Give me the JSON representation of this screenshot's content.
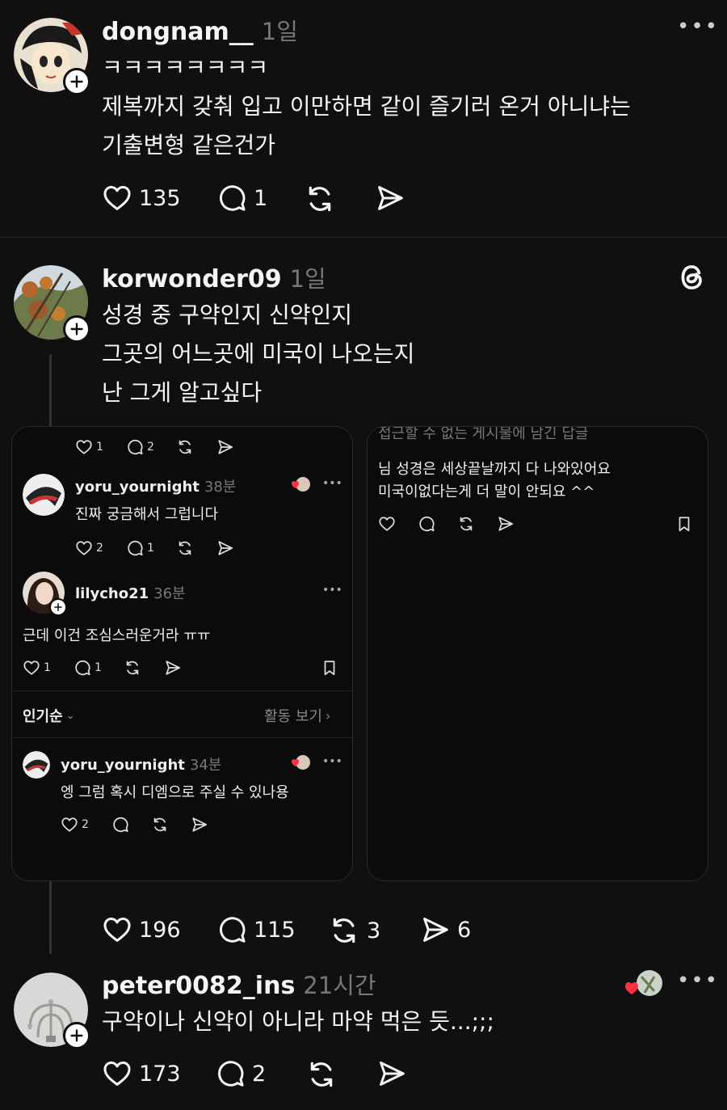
{
  "posts": [
    {
      "username": "dongnam__",
      "time": "1일",
      "lines": [
        "ㅋㅋㅋㅋㅋㅋㅋㅋ",
        "제복까지 갖춰 입고 이만하면 같이 즐기러 온거 아니냐는",
        "기출변형 같은건가"
      ],
      "likes": "135",
      "replies": "1"
    },
    {
      "username": "korwonder09",
      "time": "1일",
      "lines": [
        "성경 중 구약인지 신약인지",
        "그곳의 어느곳에 미국이 나오는지",
        "난 그게 알고싶다"
      ],
      "likes": "196",
      "replies": "115",
      "reposts": "3",
      "shares": "6"
    },
    {
      "username": "peter0082_ins",
      "time": "21시간",
      "lines": [
        "구약이나 신약이 아니라 마약 먹은 듯...;;;"
      ],
      "likes": "173",
      "replies": "2"
    }
  ],
  "left_card": {
    "top_likes": "1",
    "top_replies": "2",
    "reply1": {
      "username": "yoru_yournight",
      "time": "38분",
      "text": "진짜 궁금해서 그럽니다",
      "likes": "2",
      "replies": "1"
    },
    "reply2": {
      "username": "lilycho21",
      "time": "36분",
      "text": "근데 이건 조심스러운거라 ㅠㅠ",
      "likes": "1",
      "replies": "1"
    },
    "sort_label": "인기순",
    "activity_label": "활동 보기",
    "reply3": {
      "username": "yoru_yournight",
      "time": "34분",
      "text": "엥 그럼 혹시 디엠으로 주실 수 있나용",
      "likes": "2"
    }
  },
  "right_card": {
    "header": "접근할 수 없는 게시물에 남긴 답글",
    "lines": [
      "님 성경은 세상끝날까지 다 나와있어요",
      "미국이없다는게 더 말이 안되요 ^^"
    ]
  },
  "icons": [
    "heart-icon",
    "comment-icon",
    "repost-icon",
    "share-icon",
    "bookmark-icon",
    "threads-logo-icon",
    "more-icon",
    "plus-icon"
  ],
  "colors": {
    "background": "#101010",
    "text": "#f3f5f7",
    "muted": "#777777",
    "heart_red": "#ff3040"
  }
}
